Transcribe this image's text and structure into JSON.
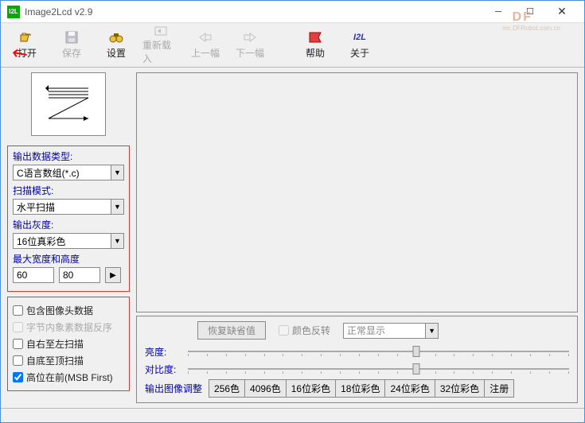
{
  "window": {
    "title": "Image2Lcd v2.9",
    "icon_text": "I2L"
  },
  "watermark": {
    "logo": "DF",
    "sub": "mc.DFRobot.com.cn"
  },
  "toolbar": {
    "open": "打开",
    "save": "保存",
    "settings": "设置",
    "reload": "重新载入",
    "prev": "上一幅",
    "next": "下一幅",
    "help": "帮助",
    "about": "关于",
    "about_icon": "I2L"
  },
  "left_panel": {
    "output_type": {
      "label": "输出数据类型:",
      "value": "C语言数组(*.c)"
    },
    "scan_mode": {
      "label": "扫描模式:",
      "value": "水平扫描"
    },
    "gray": {
      "label": "输出灰度:",
      "value": "16位真彩色"
    },
    "maxdim": {
      "label": "最大宽度和高度",
      "w": "60",
      "h": "80"
    },
    "checkboxes": {
      "include_header": "包含图像头数据",
      "byte_reverse": "字节内象素数据反序",
      "rtl": "自右至左扫描",
      "btt": "自底至顶扫描",
      "msb_first": "高位在前(MSB First)"
    }
  },
  "right_panel": {
    "restore_default": "恢复缺省值",
    "invert_colors": "颜色反转",
    "display_mode": "正常显示",
    "brightness": "亮度:",
    "contrast": "对比度:"
  },
  "tabs": {
    "label": "输出图像调整",
    "items": [
      "256色",
      "4096色",
      "16位彩色",
      "18位彩色",
      "24位彩色",
      "32位彩色",
      "注册"
    ]
  }
}
